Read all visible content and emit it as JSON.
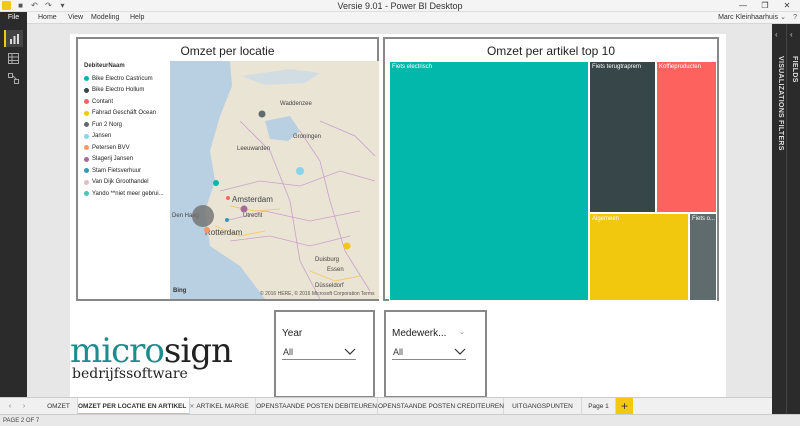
{
  "window": {
    "title": "Versie 9.01 - Power BI Desktop"
  },
  "menu": {
    "file": "File",
    "items": [
      "Home",
      "View",
      "Modeling",
      "Help"
    ],
    "user": "Marc Kleinhaarhuis"
  },
  "map_visual": {
    "title": "Omzet per locatie",
    "legend_title": "DebiteurNaam",
    "legend": [
      {
        "label": "Bike Electro Castricum",
        "color": "#01b8aa"
      },
      {
        "label": "Bike Electro Hollum",
        "color": "#374649"
      },
      {
        "label": "Contant",
        "color": "#fd625e"
      },
      {
        "label": "Fahrad Geschäft Ocean",
        "color": "#f2c80f"
      },
      {
        "label": "Fun 2 Norg",
        "color": "#5f6b6d"
      },
      {
        "label": "Jansen",
        "color": "#8ad4eb"
      },
      {
        "label": "Petersen BVV",
        "color": "#fe9666"
      },
      {
        "label": "Slagerij Jansen",
        "color": "#a66999"
      },
      {
        "label": "Stam Fietsverhuur",
        "color": "#3599b8"
      },
      {
        "label": "Van Dijk Groothandel",
        "color": "#dfbfbf"
      },
      {
        "label": "Yando **niet meer gebrui...",
        "color": "#4ac5bb"
      }
    ],
    "places": [
      "Waddenzee",
      "Groningen",
      "Leeuwarden",
      "Amsterdam",
      "Den Haag",
      "Utrecht",
      "Rotterdam",
      "Duisburg",
      "Essen",
      "Düsseldorf"
    ],
    "bing": "Bing",
    "credit": "© 2016 HERE, © 2016 Microsoft Corporation  Terms"
  },
  "treemap_visual": {
    "title": "Omzet per artikel top 10",
    "cells": [
      {
        "label": "Fiets electrisch",
        "color": "#01b8aa"
      },
      {
        "label": "Fiets terugtraprem",
        "color": "#374649"
      },
      {
        "label": "Koffieproducten",
        "color": "#fd625e"
      },
      {
        "label": "Algemeen",
        "color": "#f2c80f"
      },
      {
        "label": "Fiets o...",
        "color": "#5f6b6d"
      }
    ]
  },
  "logo": {
    "part1": "micro",
    "part2": "sign",
    "subtitle": "bedrijfssoftware",
    "color1": "#1c8c8c",
    "color2": "#222222"
  },
  "slicers": [
    {
      "title": "Year",
      "value": "All"
    },
    {
      "title": "Medewerk...",
      "value": "All"
    }
  ],
  "panes": {
    "fields": "FIELDS",
    "visualizations": "VISUALIZATIONS",
    "filters": "FILTERS"
  },
  "tabs": [
    "OMZET",
    "OMZET PER LOCATIE EN ARTIKEL",
    "ARTIKEL MARGE",
    "OPENSTAANDE POSTEN DEBITEUREN",
    "OPENSTAANDE POSTEN CREDITEUREN",
    "UITGANGSPUNTEN",
    "Page 1"
  ],
  "tab_add": "+",
  "status": "PAGE 2 OF 7"
}
